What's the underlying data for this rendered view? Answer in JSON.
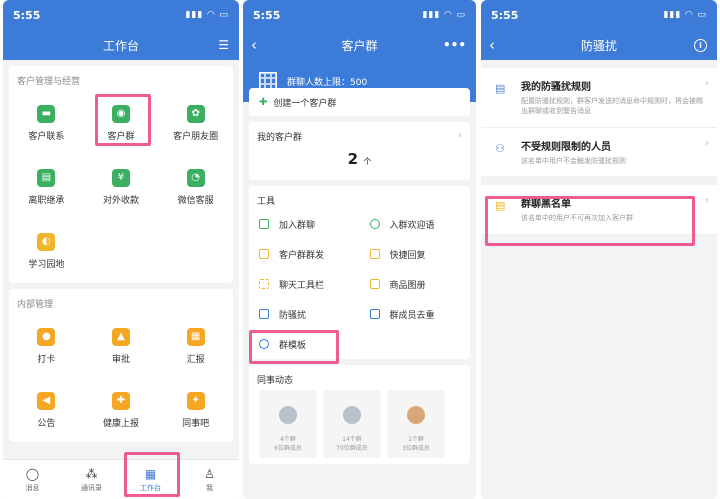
{
  "panel1": {
    "status_time": "5:55",
    "title": "工作台",
    "section1_title": "客户管理与经营",
    "section1_items": [
      "客户联系",
      "客户群",
      "客户朋友圈",
      "离职继承",
      "对外收款",
      "微信客服",
      "学习园地"
    ],
    "section2_title": "内部管理",
    "section2_items": [
      "打卡",
      "审批",
      "汇报",
      "公告",
      "健康上报",
      "同事吧"
    ],
    "tabs": [
      "消息",
      "通讯录",
      "工作台",
      "我"
    ]
  },
  "panel2": {
    "status_time": "5:55",
    "title": "客户群",
    "more": "•••",
    "limit_text": "群聊人数上限：500",
    "create_label": "创建一个客户群",
    "my_groups_title": "我的客户群",
    "my_groups_count": "2",
    "my_groups_unit": "个",
    "tools_title": "工具",
    "tools": [
      "加入群聊",
      "入群欢迎语",
      "客户群群发",
      "快捷回复",
      "聊天工具栏",
      "商品图册",
      "防骚扰",
      "群成员去重",
      "群模板"
    ],
    "dynamics_title": "同事动态",
    "dynamics": [
      {
        "line1": "4个群",
        "line2": "6位群成员"
      },
      {
        "line1": "14个群",
        "line2": "70位群成员"
      },
      {
        "line1": "1个群",
        "line2": "3位群成员"
      }
    ]
  },
  "panel3": {
    "status_time": "5:55",
    "title": "防骚扰",
    "info": "i",
    "rules": [
      {
        "title": "我的防骚扰规则",
        "desc": "配置防骚扰规则，群客户发送的消息命中规则时，将会被踢出群聊或收到警告消息"
      },
      {
        "title": "不受规则限制的人员",
        "desc": "该名单中用户不会触发防骚扰规则"
      },
      {
        "title": "群聊黑名单",
        "desc": "该名单中的用户不可再次加入客户群"
      }
    ]
  },
  "colors": {
    "primary": "#3d7bd8",
    "highlight": "#ee5b93",
    "green": "#3cb061"
  }
}
